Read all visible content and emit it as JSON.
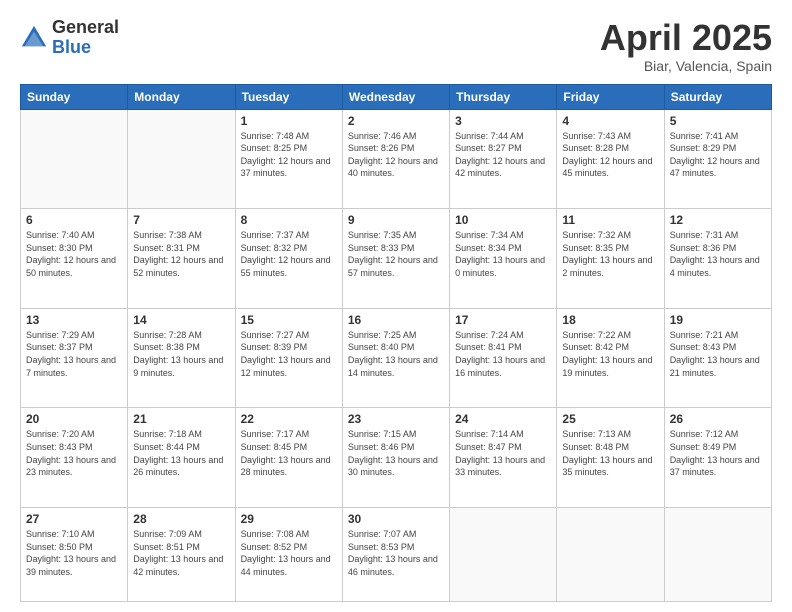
{
  "header": {
    "logo_general": "General",
    "logo_blue": "Blue",
    "title": "April 2025",
    "location": "Biar, Valencia, Spain"
  },
  "days_of_week": [
    "Sunday",
    "Monday",
    "Tuesday",
    "Wednesday",
    "Thursday",
    "Friday",
    "Saturday"
  ],
  "weeks": [
    [
      {
        "day": "",
        "info": ""
      },
      {
        "day": "",
        "info": ""
      },
      {
        "day": "1",
        "info": "Sunrise: 7:48 AM\nSunset: 8:25 PM\nDaylight: 12 hours and 37 minutes."
      },
      {
        "day": "2",
        "info": "Sunrise: 7:46 AM\nSunset: 8:26 PM\nDaylight: 12 hours and 40 minutes."
      },
      {
        "day": "3",
        "info": "Sunrise: 7:44 AM\nSunset: 8:27 PM\nDaylight: 12 hours and 42 minutes."
      },
      {
        "day": "4",
        "info": "Sunrise: 7:43 AM\nSunset: 8:28 PM\nDaylight: 12 hours and 45 minutes."
      },
      {
        "day": "5",
        "info": "Sunrise: 7:41 AM\nSunset: 8:29 PM\nDaylight: 12 hours and 47 minutes."
      }
    ],
    [
      {
        "day": "6",
        "info": "Sunrise: 7:40 AM\nSunset: 8:30 PM\nDaylight: 12 hours and 50 minutes."
      },
      {
        "day": "7",
        "info": "Sunrise: 7:38 AM\nSunset: 8:31 PM\nDaylight: 12 hours and 52 minutes."
      },
      {
        "day": "8",
        "info": "Sunrise: 7:37 AM\nSunset: 8:32 PM\nDaylight: 12 hours and 55 minutes."
      },
      {
        "day": "9",
        "info": "Sunrise: 7:35 AM\nSunset: 8:33 PM\nDaylight: 12 hours and 57 minutes."
      },
      {
        "day": "10",
        "info": "Sunrise: 7:34 AM\nSunset: 8:34 PM\nDaylight: 13 hours and 0 minutes."
      },
      {
        "day": "11",
        "info": "Sunrise: 7:32 AM\nSunset: 8:35 PM\nDaylight: 13 hours and 2 minutes."
      },
      {
        "day": "12",
        "info": "Sunrise: 7:31 AM\nSunset: 8:36 PM\nDaylight: 13 hours and 4 minutes."
      }
    ],
    [
      {
        "day": "13",
        "info": "Sunrise: 7:29 AM\nSunset: 8:37 PM\nDaylight: 13 hours and 7 minutes."
      },
      {
        "day": "14",
        "info": "Sunrise: 7:28 AM\nSunset: 8:38 PM\nDaylight: 13 hours and 9 minutes."
      },
      {
        "day": "15",
        "info": "Sunrise: 7:27 AM\nSunset: 8:39 PM\nDaylight: 13 hours and 12 minutes."
      },
      {
        "day": "16",
        "info": "Sunrise: 7:25 AM\nSunset: 8:40 PM\nDaylight: 13 hours and 14 minutes."
      },
      {
        "day": "17",
        "info": "Sunrise: 7:24 AM\nSunset: 8:41 PM\nDaylight: 13 hours and 16 minutes."
      },
      {
        "day": "18",
        "info": "Sunrise: 7:22 AM\nSunset: 8:42 PM\nDaylight: 13 hours and 19 minutes."
      },
      {
        "day": "19",
        "info": "Sunrise: 7:21 AM\nSunset: 8:43 PM\nDaylight: 13 hours and 21 minutes."
      }
    ],
    [
      {
        "day": "20",
        "info": "Sunrise: 7:20 AM\nSunset: 8:43 PM\nDaylight: 13 hours and 23 minutes."
      },
      {
        "day": "21",
        "info": "Sunrise: 7:18 AM\nSunset: 8:44 PM\nDaylight: 13 hours and 26 minutes."
      },
      {
        "day": "22",
        "info": "Sunrise: 7:17 AM\nSunset: 8:45 PM\nDaylight: 13 hours and 28 minutes."
      },
      {
        "day": "23",
        "info": "Sunrise: 7:15 AM\nSunset: 8:46 PM\nDaylight: 13 hours and 30 minutes."
      },
      {
        "day": "24",
        "info": "Sunrise: 7:14 AM\nSunset: 8:47 PM\nDaylight: 13 hours and 33 minutes."
      },
      {
        "day": "25",
        "info": "Sunrise: 7:13 AM\nSunset: 8:48 PM\nDaylight: 13 hours and 35 minutes."
      },
      {
        "day": "26",
        "info": "Sunrise: 7:12 AM\nSunset: 8:49 PM\nDaylight: 13 hours and 37 minutes."
      }
    ],
    [
      {
        "day": "27",
        "info": "Sunrise: 7:10 AM\nSunset: 8:50 PM\nDaylight: 13 hours and 39 minutes."
      },
      {
        "day": "28",
        "info": "Sunrise: 7:09 AM\nSunset: 8:51 PM\nDaylight: 13 hours and 42 minutes."
      },
      {
        "day": "29",
        "info": "Sunrise: 7:08 AM\nSunset: 8:52 PM\nDaylight: 13 hours and 44 minutes."
      },
      {
        "day": "30",
        "info": "Sunrise: 7:07 AM\nSunset: 8:53 PM\nDaylight: 13 hours and 46 minutes."
      },
      {
        "day": "",
        "info": ""
      },
      {
        "day": "",
        "info": ""
      },
      {
        "day": "",
        "info": ""
      }
    ]
  ]
}
